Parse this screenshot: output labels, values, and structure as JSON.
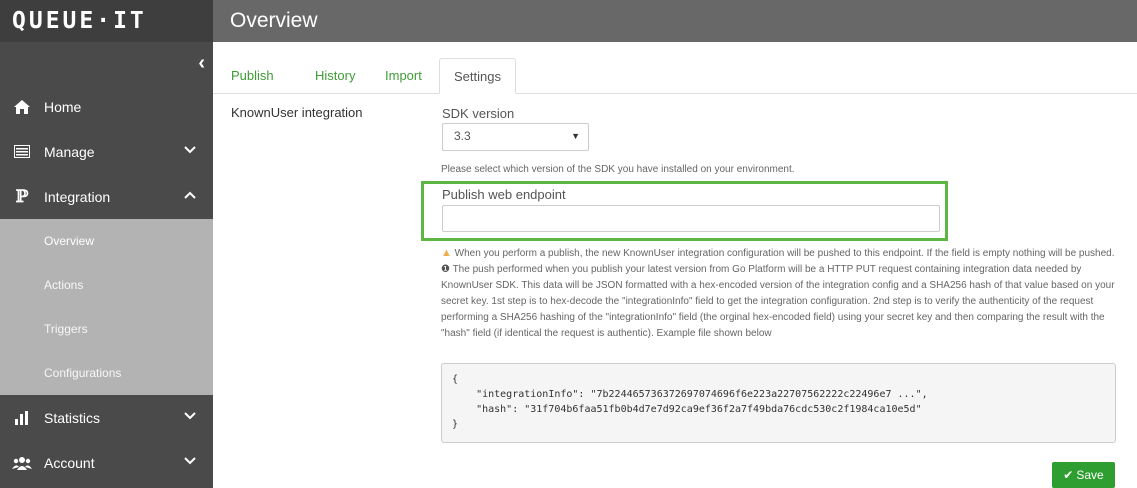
{
  "brand": {
    "logo_text": "QUEUE·IT"
  },
  "header": {
    "title": "Overview"
  },
  "sidebar": {
    "collapse_icon": "chevron-left-icon",
    "items": [
      {
        "label": "Home",
        "icon": "home-icon"
      },
      {
        "label": "Manage",
        "icon": "manage-icon"
      },
      {
        "label": "Integration",
        "icon": "integration-icon"
      },
      {
        "label": "Statistics",
        "icon": "statistics-icon"
      },
      {
        "label": "Account",
        "icon": "account-icon"
      }
    ],
    "subitems": [
      {
        "label": "Overview"
      },
      {
        "label": "Actions"
      },
      {
        "label": "Triggers"
      },
      {
        "label": "Configurations"
      }
    ]
  },
  "tabs": [
    {
      "label": "Publish"
    },
    {
      "label": "History"
    },
    {
      "label": "Import"
    },
    {
      "label": "Settings"
    }
  ],
  "settings": {
    "section_label": "KnownUser integration",
    "sdk_label": "SDK version",
    "sdk_value": "3.3",
    "sdk_help": "Please select which version of the SDK you have installed on your environment.",
    "publish_label": "Publish web endpoint",
    "publish_value": "",
    "warning_text": "When you perform a publish, the new KnownUser integration configuration will be pushed to this endpoint. If the field is empty nothing will be pushed.",
    "info_text": "The push performed when you publish your latest version from Go Platform will be a HTTP PUT request containing integration data needed by KnownUser SDK. This data will be JSON formatted with a hex-encoded version of the integration config and a SHA256 hash of that value based on your secret key. 1st step is to hex-decode the \"integrationInfo\" field to get the integration configuration. 2nd step is to verify the authenticity of the request performing a SHA256 hashing of the \"integrationInfo\" field (the orginal hex-encoded field) using your secret key and then comparing the result with the \"hash\" field (if identical the request is authentic). Example file shown below",
    "code_example": "{\n    \"integrationInfo\": \"7b224465736372697074696f6e223a22707562222c22496e7 ...\",\n    \"hash\": \"31f704b6faa51fb0b4d7e7d92ca9ef36f2a7f49bda76cdc530c2f1984ca10e5d\"\n}",
    "save_label": "Save"
  },
  "colors": {
    "accent": "#3f9c35",
    "highlight": "#5db544",
    "save": "#2e9e30",
    "sidebar": "#4a4a4a",
    "header": "#686868"
  }
}
